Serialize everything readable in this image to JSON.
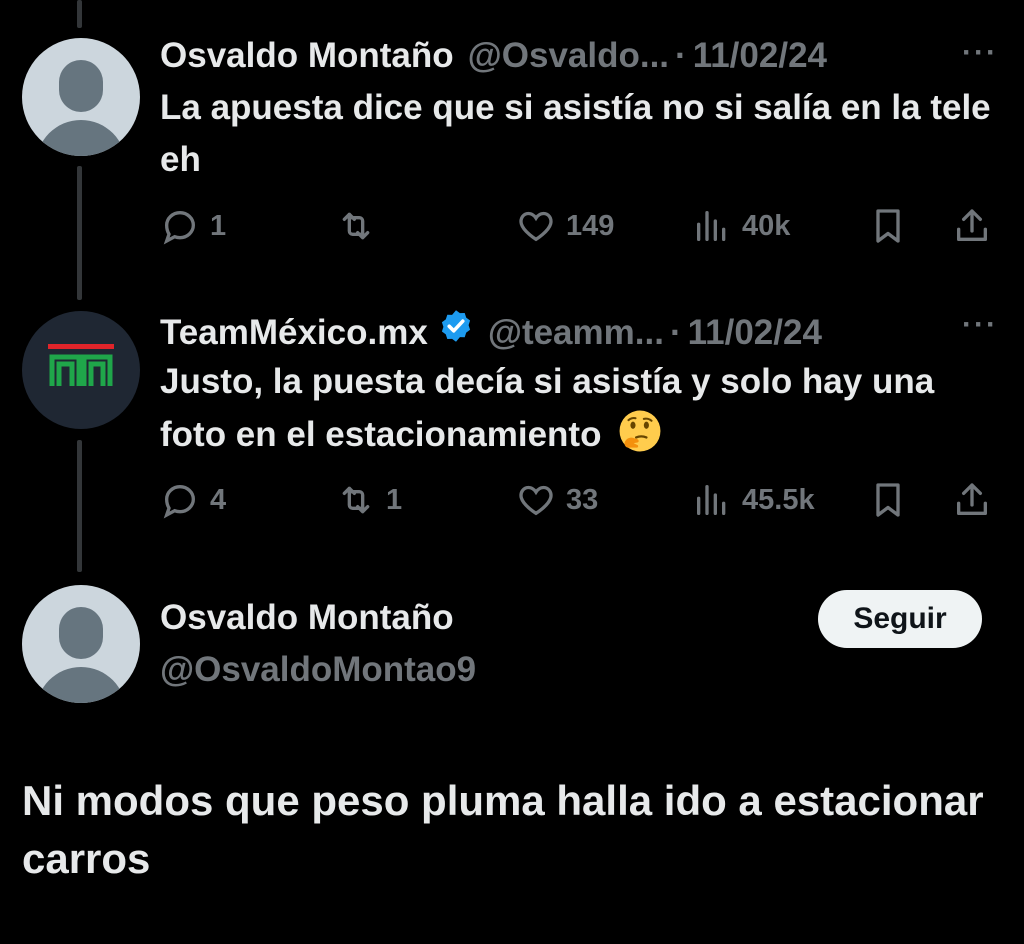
{
  "thread": [
    {
      "author": {
        "display_name": "Osvaldo Montaño",
        "handle": "@Osvaldo...",
        "avatar": "default-avatar"
      },
      "date": "11/02/24",
      "separator": "·",
      "more": "···",
      "text": "La apuesta dice que si asistía no si salía en la tele eh",
      "actions": {
        "replies": "1",
        "retweets": "",
        "likes": "149",
        "views": "40k"
      }
    },
    {
      "author": {
        "display_name": "TeamMéxico.mx",
        "handle": "@teamm...",
        "verified": true,
        "avatar": "teammexico-logo"
      },
      "date": "11/02/24",
      "separator": "·",
      "more": "···",
      "text": "Justo, la puesta decía si asistía y solo hay una foto en el estacionamiento",
      "emoji": "thinking-face",
      "actions": {
        "replies": "4",
        "retweets": "1",
        "likes": "33",
        "views": "45.5k"
      }
    }
  ],
  "main_tweet": {
    "author": {
      "display_name": "Osvaldo Montaño",
      "handle": "@OsvaldoMontao9",
      "avatar": "default-avatar"
    },
    "follow_label": "Seguir",
    "text": "Ni modos que peso pluma halla ido a estacionar carros"
  },
  "colors": {
    "background": "#000000",
    "text_primary": "#e7e9ea",
    "text_secondary": "#71767b",
    "verified_blue": "#1d9bf0",
    "follow_bg": "#eff3f4"
  }
}
